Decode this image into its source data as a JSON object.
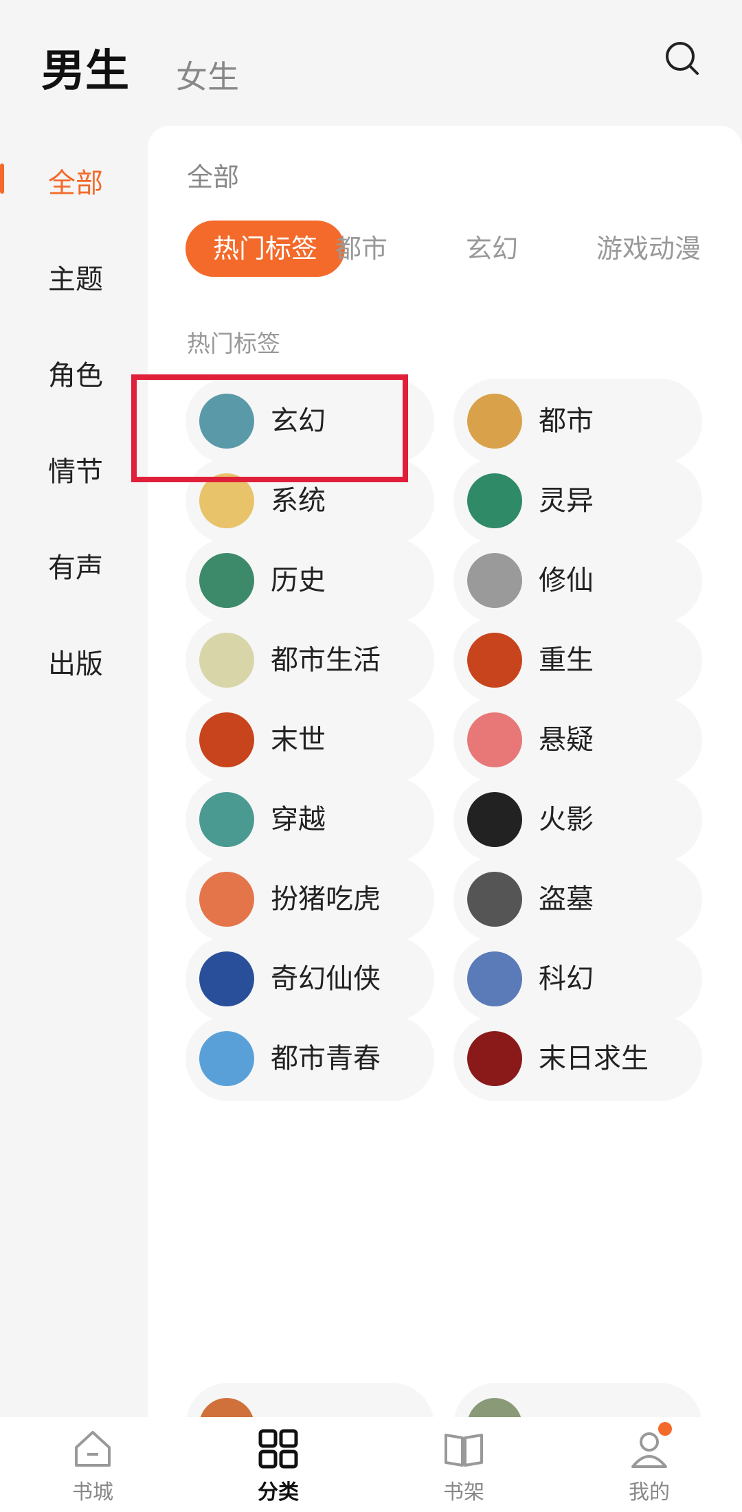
{
  "header": {
    "tab_male": "男生",
    "tab_female": "女生",
    "search_icon": "search-icon"
  },
  "sidebar": {
    "items": [
      {
        "label": "全部",
        "active": true
      },
      {
        "label": "主题"
      },
      {
        "label": "角色"
      },
      {
        "label": "情节"
      },
      {
        "label": "有声"
      },
      {
        "label": "出版"
      }
    ]
  },
  "main": {
    "title": "全部",
    "chips": [
      {
        "label": "热门标签",
        "active": true
      },
      {
        "label": "都市"
      },
      {
        "label": "玄幻"
      },
      {
        "label": "游戏动漫"
      }
    ],
    "section_title": "热门标签",
    "tags": [
      {
        "label": "玄幻",
        "icon": "mountain-icon",
        "color": "#5a9aa8"
      },
      {
        "label": "都市",
        "icon": "city-icon",
        "color": "#d9a24a"
      },
      {
        "label": "系统",
        "icon": "screen-icon",
        "color": "#e8c36a"
      },
      {
        "label": "灵异",
        "icon": "wave-icon",
        "color": "#2f8a68"
      },
      {
        "label": "历史",
        "icon": "scroll-icon",
        "color": "#3d8a6a"
      },
      {
        "label": "修仙",
        "icon": "immortal-icon",
        "color": "#9a9a9a"
      },
      {
        "label": "都市生活",
        "icon": "coffee-icon",
        "color": "#d8d6a8"
      },
      {
        "label": "重生",
        "icon": "butterfly-icon",
        "color": "#c8441c"
      },
      {
        "label": "末世",
        "icon": "fire-icon",
        "color": "#c8441c"
      },
      {
        "label": "悬疑",
        "icon": "crow-icon",
        "color": "#e87878"
      },
      {
        "label": "穿越",
        "icon": "gourd-icon",
        "color": "#4a9a92"
      },
      {
        "label": "火影",
        "icon": "ninja-icon",
        "color": "#222222"
      },
      {
        "label": "扮猪吃虎",
        "icon": "pig-icon",
        "color": "#e4754a"
      },
      {
        "label": "盗墓",
        "icon": "tombstone-icon",
        "color": "#555555"
      },
      {
        "label": "奇幻仙侠",
        "icon": "sword-icon",
        "color": "#2a4f9a"
      },
      {
        "label": "科幻",
        "icon": "planet-icon",
        "color": "#5a7ab8"
      },
      {
        "label": "都市青春",
        "icon": "jacket-icon",
        "color": "#5aa0d8"
      },
      {
        "label": "末日求生",
        "icon": "skull-icon",
        "color": "#8a1a1a"
      }
    ]
  },
  "bottom_nav": [
    {
      "label": "书城",
      "icon": "home-icon"
    },
    {
      "label": "分类",
      "icon": "category-icon",
      "active": true
    },
    {
      "label": "书架",
      "icon": "book-icon"
    },
    {
      "label": "我的",
      "icon": "profile-icon"
    }
  ]
}
